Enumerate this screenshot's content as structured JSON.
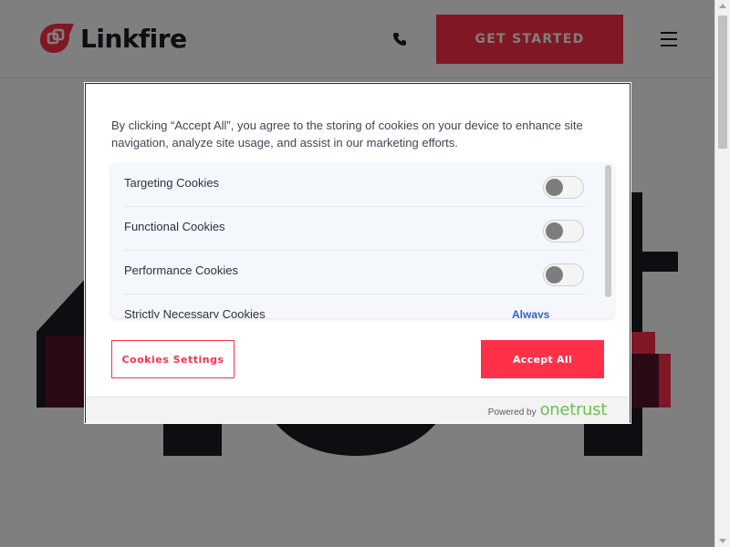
{
  "header": {
    "brand": "Linkfire",
    "cta_label": "GET STARTED",
    "icons": {
      "phone": "phone-icon",
      "menu": "hamburger-menu-icon",
      "logo": "linkfire-logo-icon"
    },
    "colors": {
      "accent": "#ff3148",
      "text": "#1b1b24"
    }
  },
  "cookie_banner": {
    "description": "By clicking “Accept All”, you agree to the storing of cookies on your device to enhance site navigation, analyze site usage, and assist in our marketing efforts.",
    "preferences": [
      {
        "label": "Targeting Cookies",
        "state": "off"
      },
      {
        "label": "Functional Cookies",
        "state": "off"
      },
      {
        "label": "Performance Cookies",
        "state": "off"
      },
      {
        "label": "Strictly Necessary Cookies",
        "status": "Always Active"
      }
    ],
    "settings_button": "Cookies Settings",
    "accept_button": "Accept All",
    "powered_by": "Powered by",
    "provider": "onetrust",
    "colors": {
      "accent": "#ff3148",
      "always_active": "#3860be",
      "provider": "#6cc04a"
    }
  }
}
